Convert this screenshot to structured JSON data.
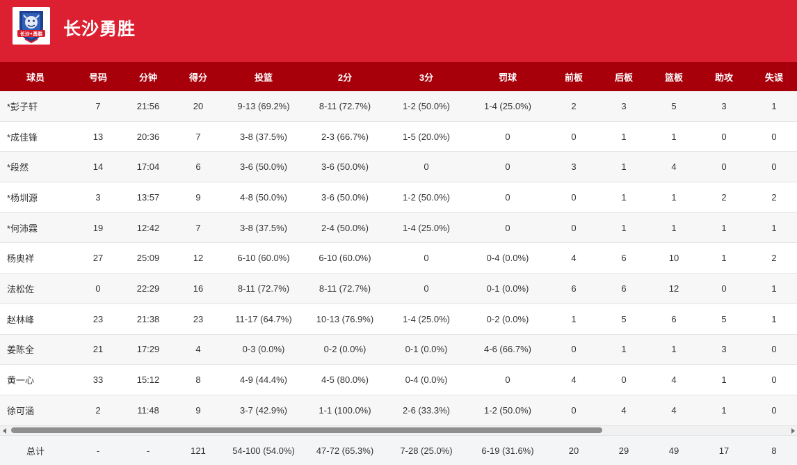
{
  "team": {
    "name": "长沙勇胜",
    "logo_text": "长沙•勇胜"
  },
  "columns": [
    "球员",
    "号码",
    "分钟",
    "得分",
    "投篮",
    "2分",
    "3分",
    "罚球",
    "前板",
    "后板",
    "篮板",
    "助攻",
    "失误"
  ],
  "rows": [
    [
      "*彭子轩",
      "7",
      "21:56",
      "20",
      "9-13 (69.2%)",
      "8-11 (72.7%)",
      "1-2 (50.0%)",
      "1-4 (25.0%)",
      "2",
      "3",
      "5",
      "3",
      "1"
    ],
    [
      "*成佳锋",
      "13",
      "20:36",
      "7",
      "3-8 (37.5%)",
      "2-3 (66.7%)",
      "1-5 (20.0%)",
      "0",
      "0",
      "1",
      "1",
      "0",
      "0"
    ],
    [
      "*段然",
      "14",
      "17:04",
      "6",
      "3-6 (50.0%)",
      "3-6 (50.0%)",
      "0",
      "0",
      "3",
      "1",
      "4",
      "0",
      "0"
    ],
    [
      "*杨圳源",
      "3",
      "13:57",
      "9",
      "4-8 (50.0%)",
      "3-6 (50.0%)",
      "1-2 (50.0%)",
      "0",
      "0",
      "1",
      "1",
      "2",
      "2"
    ],
    [
      "*何沛霖",
      "19",
      "12:42",
      "7",
      "3-8 (37.5%)",
      "2-4 (50.0%)",
      "1-4 (25.0%)",
      "0",
      "0",
      "1",
      "1",
      "1",
      "1"
    ],
    [
      "杨奥祥",
      "27",
      "25:09",
      "12",
      "6-10 (60.0%)",
      "6-10 (60.0%)",
      "0",
      "0-4 (0.0%)",
      "4",
      "6",
      "10",
      "1",
      "2"
    ],
    [
      "法松佐",
      "0",
      "22:29",
      "16",
      "8-11 (72.7%)",
      "8-11 (72.7%)",
      "0",
      "0-1 (0.0%)",
      "6",
      "6",
      "12",
      "0",
      "1"
    ],
    [
      "赵林峰",
      "23",
      "21:38",
      "23",
      "11-17 (64.7%)",
      "10-13 (76.9%)",
      "1-4 (25.0%)",
      "0-2 (0.0%)",
      "1",
      "5",
      "6",
      "5",
      "1"
    ],
    [
      "姜陈全",
      "21",
      "17:29",
      "4",
      "0-3 (0.0%)",
      "0-2 (0.0%)",
      "0-1 (0.0%)",
      "4-6 (66.7%)",
      "0",
      "1",
      "1",
      "3",
      "0"
    ],
    [
      "黄一心",
      "33",
      "15:12",
      "8",
      "4-9 (44.4%)",
      "4-5 (80.0%)",
      "0-4 (0.0%)",
      "0",
      "4",
      "0",
      "4",
      "1",
      "0"
    ],
    [
      "徐可涵",
      "2",
      "11:48",
      "9",
      "3-7 (42.9%)",
      "1-1 (100.0%)",
      "2-6 (33.3%)",
      "1-2 (50.0%)",
      "0",
      "4",
      "4",
      "1",
      "0"
    ]
  ],
  "totals": [
    "总计",
    "-",
    "-",
    "121",
    "54-100 (54.0%)",
    "47-72 (65.3%)",
    "7-28 (25.0%)",
    "6-19 (31.6%)",
    "20",
    "29",
    "49",
    "17",
    "8"
  ],
  "colors": {
    "header_bg": "#dc1f31",
    "table_header_bg": "#a8000b"
  },
  "icons": {
    "scroll_left": "scroll-left-arrow-icon",
    "scroll_right": "scroll-right-arrow-icon",
    "logo": "lion-logo-icon"
  }
}
